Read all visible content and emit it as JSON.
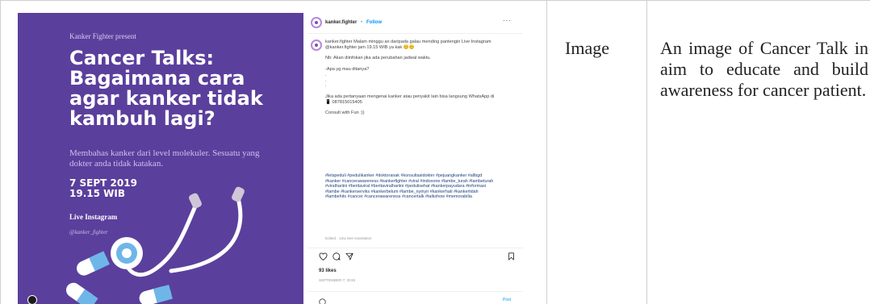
{
  "poster": {
    "presenter": "Kanker Fighter present",
    "title": "Cancer Talks: Bagaimana cara agar kanker tidak kambuh lagi?",
    "description": "Membahas kanker dari level molekuler. Sesuatu yang dokter anda tidak katakan.",
    "date": "7 SEPT 2019",
    "time": "19.15 WIB",
    "live": "Live Instagram",
    "handle": "@kanker_fighter",
    "colors": {
      "background": "#5b3f9c",
      "stethoscope": "#ffffff",
      "pill_blue": "#6fb6e8"
    }
  },
  "instagram": {
    "username": "kanker.fighter",
    "separator": "•",
    "follow": "Follow",
    "more_icon": "more-dots-icon",
    "caption": "kanker.fighter Malam minggu an daripada galau mending pantengin Live Instagram @kanker.fighter jam 19.15 WIB ya kak 😊😊\n\nNb: Akan diinfokan jika ada perubahan jadwal waktu.\n\n-Apa yg mau ditanya?\n.\n.\n.\n\nJika ada pertanyaan mengenai kanker atau penyakit lain bisa langsung WhatsApp di\n📱 087815015405\n\nConsult with Fun :))",
    "hashtags": "#letspeduli #pedulikanker #doktoranak #konsultasidokter #pejuangkanker #allbgd #kanker #cancerawareness #kankerfighter #viral #indoxone #lambe_turah #lambeturah #viralhariini #beritaviral #beritaviralhariini #pedulisehat #kankerpayudara #informasi #lambe #kankerserviks #kankerbelum #lambe_nyinyir #kankerhati #kankerlidah #lambehits #cancer #cancerawareness #cancertalk #talkshow #memorabilia",
    "meta": "Edited · 13w   See translation",
    "likes": "93 likes",
    "posted": "SEPTEMBER 7, 2019",
    "post_button": "Post",
    "icons": [
      "heart-icon",
      "comment-icon",
      "share-icon",
      "bookmark-icon"
    ]
  },
  "cells": {
    "type": "Image",
    "description": "An image of Cancer Talk in aim to educate and build awareness for cancer patient."
  }
}
